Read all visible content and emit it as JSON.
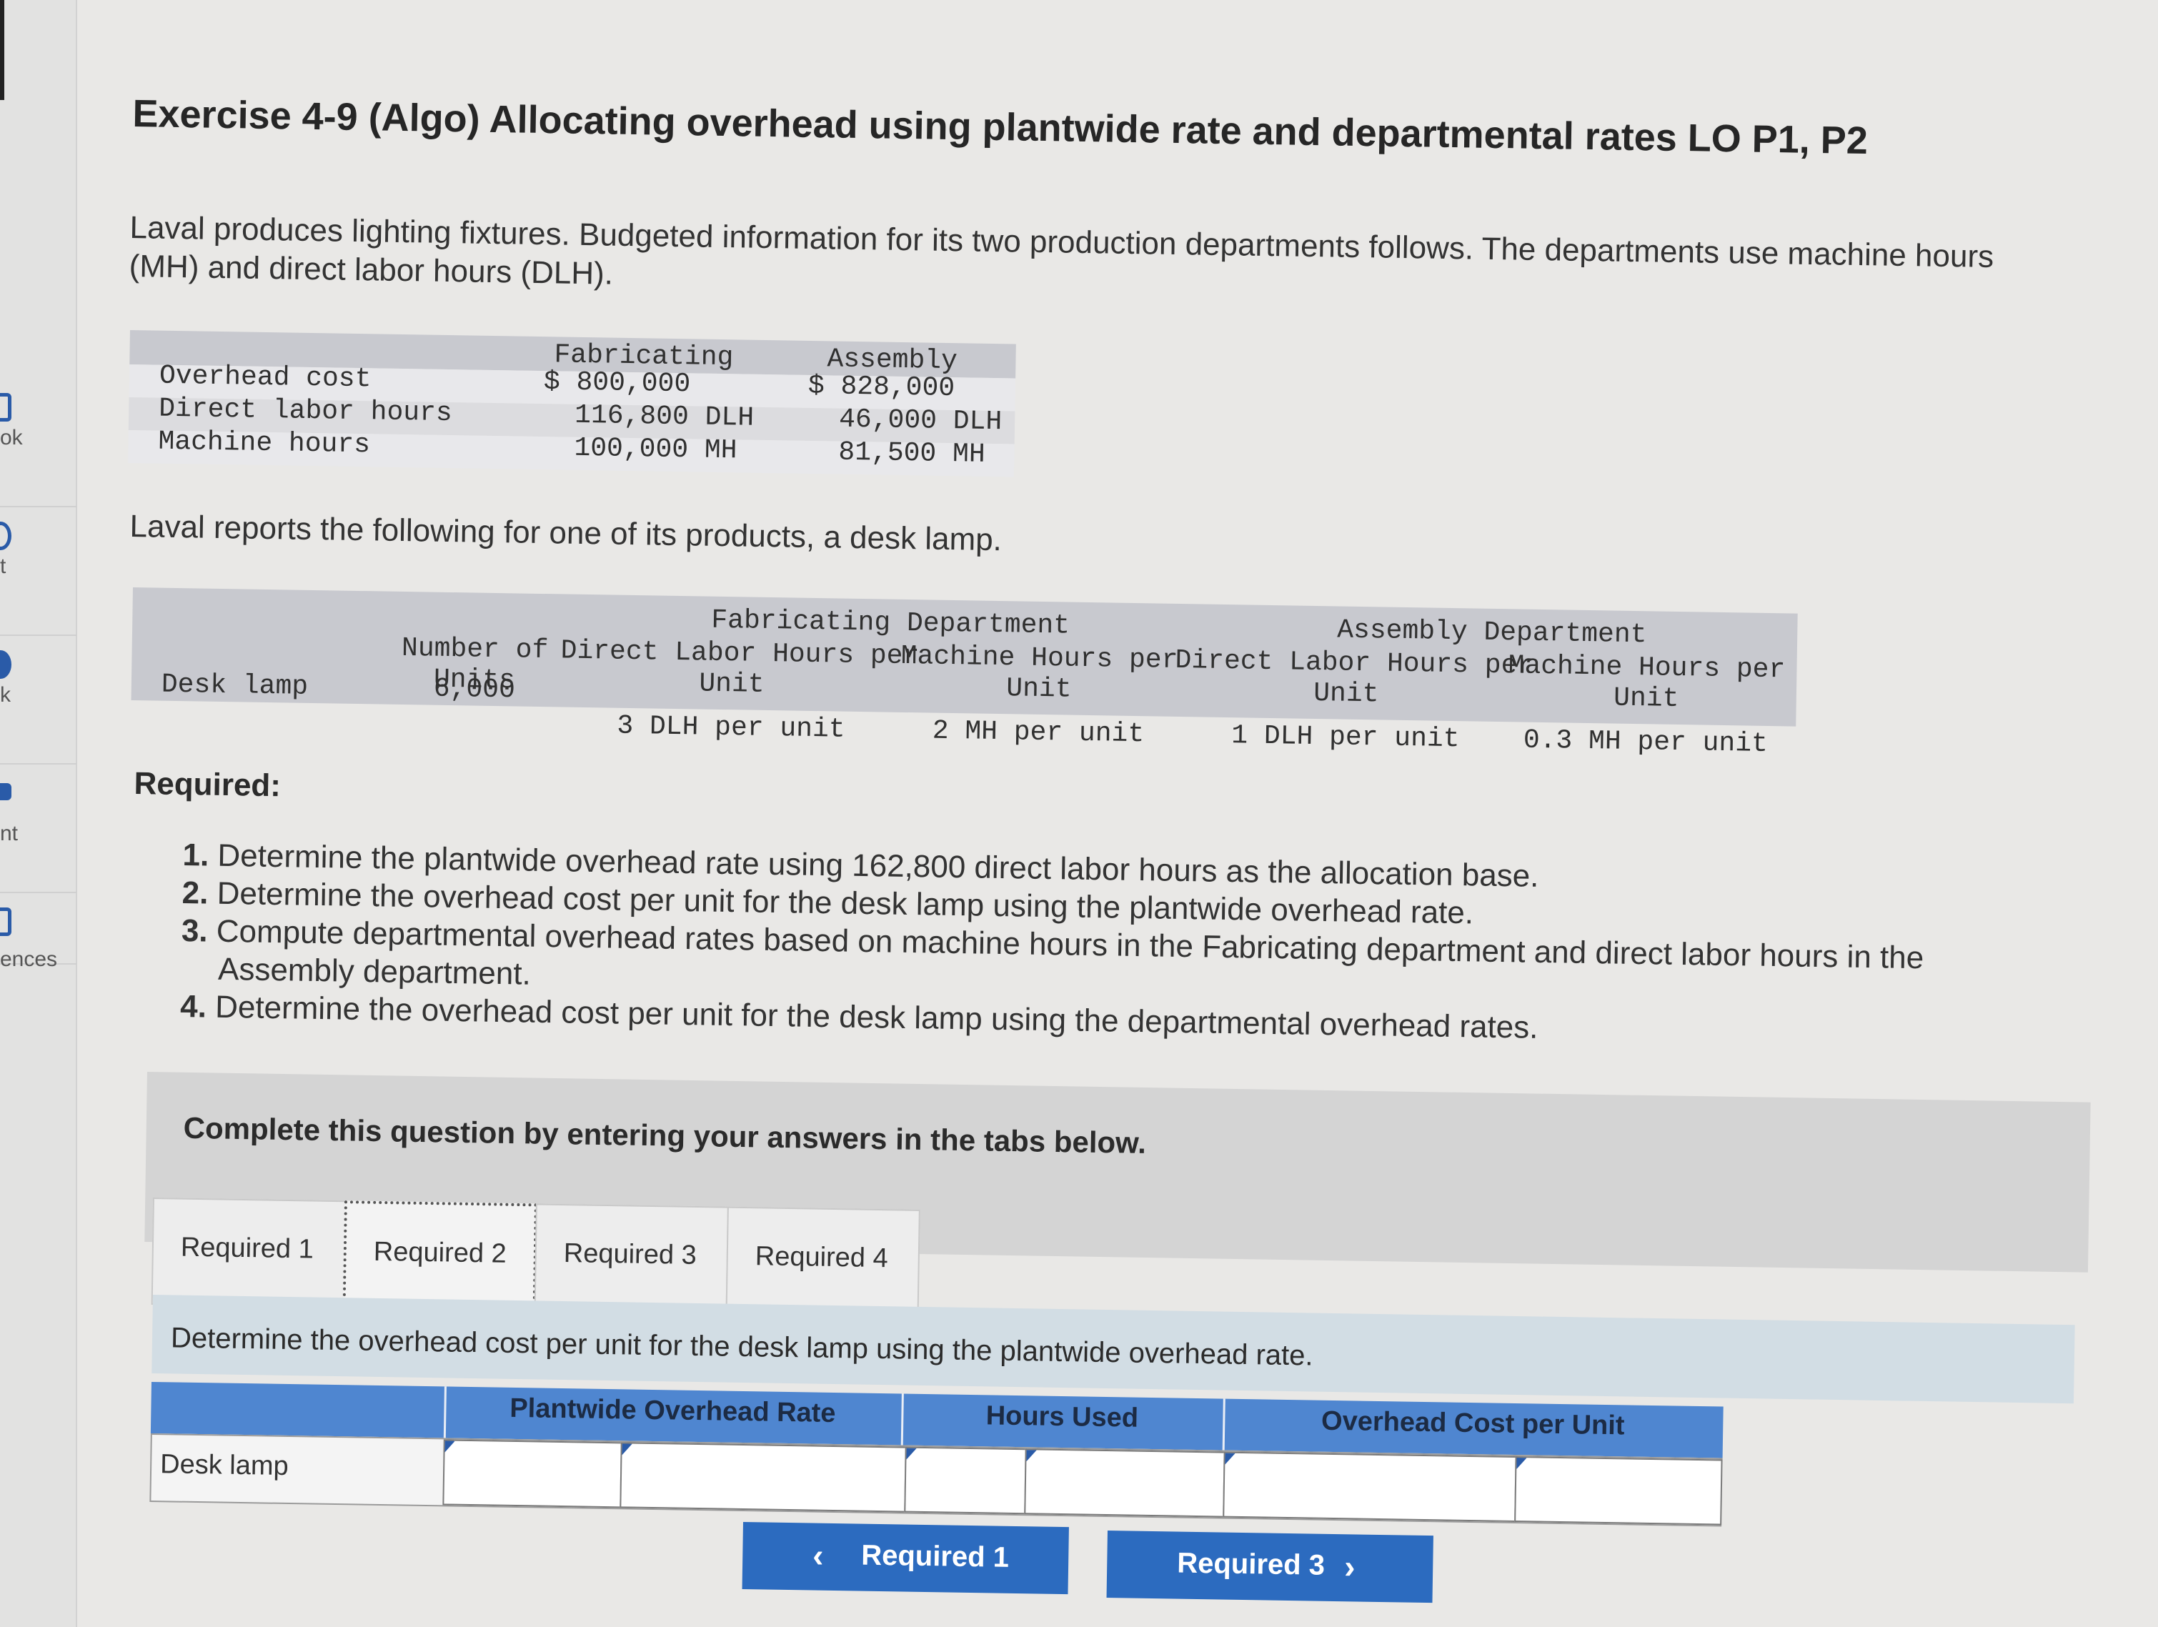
{
  "sidebar": {
    "items": [
      {
        "label": "ok"
      },
      {
        "label": "t"
      },
      {
        "label": "k"
      },
      {
        "label": "nt"
      },
      {
        "label": "ences"
      }
    ]
  },
  "title": "Exercise 4-9 (Algo) Allocating overhead using plantwide rate and departmental rates LO P1, P2",
  "intro_line1": "Laval produces lighting fixtures. Budgeted information for its two production departments follows. The departments use machine hours",
  "intro_line2": "(MH) and direct labor hours (DLH).",
  "budget_table": {
    "headers": [
      "Fabricating",
      "Assembly"
    ],
    "rows": [
      {
        "label": "Overhead cost",
        "fab": "$ 800,000",
        "asm": "$ 828,000"
      },
      {
        "label": "Direct labor hours",
        "fab": "116,800 DLH",
        "asm": "46,000 DLH"
      },
      {
        "label": "Machine hours",
        "fab": "100,000 MH",
        "asm": "81,500 MH"
      }
    ]
  },
  "product_sentence": "Laval reports the following for one of its products, a desk lamp.",
  "product_table": {
    "group_headers": [
      "Fabricating Department",
      "Assembly Department"
    ],
    "col_headers": [
      "Number of\nUnits",
      "Direct Labor Hours per\nUnit",
      "Machine Hours per\nUnit",
      "Direct Labor Hours per\nUnit",
      "Machine Hours per\nUnit"
    ],
    "row": {
      "label": "Desk lamp",
      "values": [
        "6,000",
        "3 DLH per unit",
        "2 MH per unit",
        "1 DLH per unit",
        "0.3 MH per unit"
      ]
    }
  },
  "required_heading": "Required:",
  "requirements": [
    {
      "num": "1.",
      "text": "Determine the plantwide overhead rate using 162,800 direct labor hours as the allocation base."
    },
    {
      "num": "2.",
      "text": "Determine the overhead cost per unit for the desk lamp using the plantwide overhead rate."
    },
    {
      "num": "3.",
      "text": "Compute departmental overhead rates based on machine hours in the Fabricating department and direct labor hours in the",
      "cont": "Assembly department."
    },
    {
      "num": "4.",
      "text": "Determine the overhead cost per unit for the desk lamp using the departmental overhead rates."
    }
  ],
  "panel_text": "Complete this question by entering your answers in the tabs below.",
  "tabs": [
    "Required 1",
    "Required 2",
    "Required 3",
    "Required 4"
  ],
  "active_tab": "Required 2",
  "instruction": "Determine the overhead cost per unit for the desk lamp using the plantwide overhead rate.",
  "answer_table": {
    "headers": [
      "Plantwide Overhead Rate",
      "Hours Used",
      "Overhead Cost per Unit"
    ],
    "row_label": "Desk lamp"
  },
  "nav": {
    "prev_label": "Required 1",
    "next_label": "Required 3"
  },
  "colors": {
    "accent": "#2c6bbf",
    "table_header_blue": "#4f86d0",
    "grey_band": "#c8c9cf"
  }
}
